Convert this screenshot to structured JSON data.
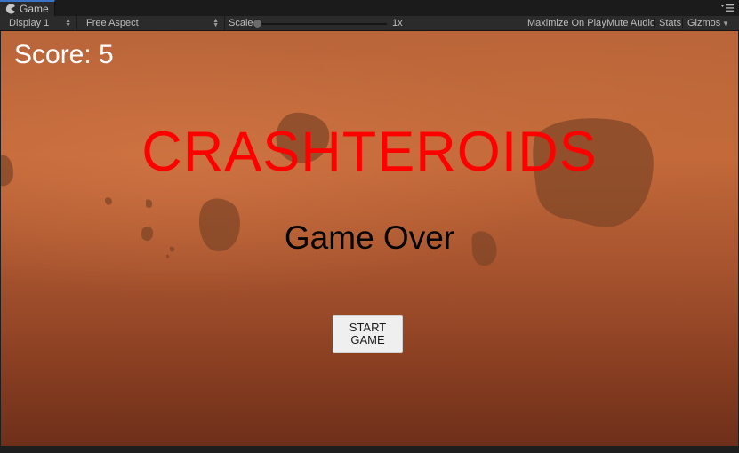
{
  "tab": {
    "title": "Game",
    "icon": "pacman-game-icon"
  },
  "toolbar": {
    "display": "Display 1",
    "aspect": "Free Aspect",
    "scale_label": "Scale",
    "scale_value": "1x",
    "maximize": "Maximize On Play",
    "mute": "Mute Audio",
    "stats": "Stats",
    "gizmos": "Gizmos"
  },
  "game": {
    "score": "Score: 5",
    "title": "CRASHTEROIDS",
    "status": "Game Over",
    "start_button": "START GAME"
  },
  "colors": {
    "title": "#ff0000",
    "tab_accent": "#3a72c8",
    "background": "#b9653a"
  }
}
